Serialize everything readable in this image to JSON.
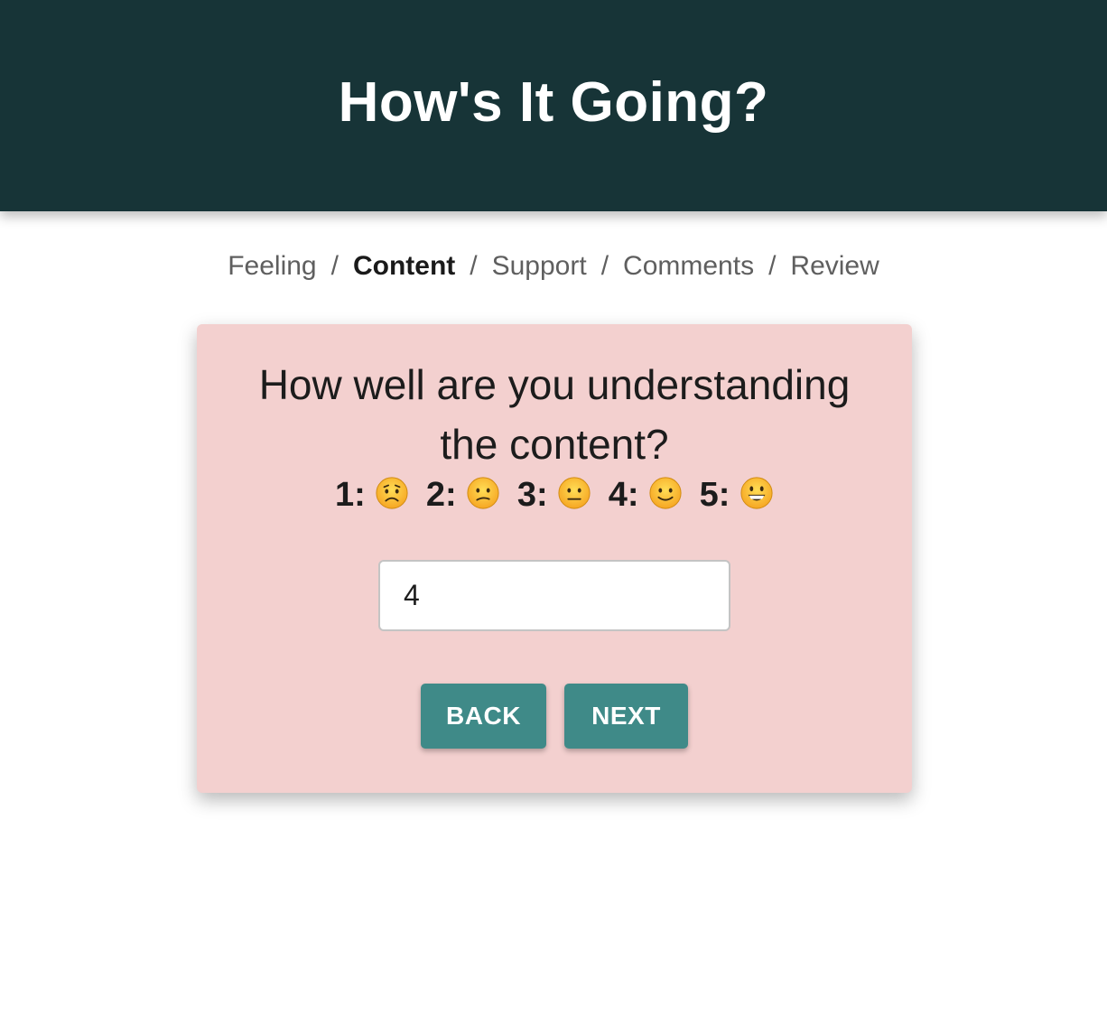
{
  "header": {
    "title": "How's It Going?",
    "bg_color": "#173437"
  },
  "breadcrumb": {
    "items": [
      {
        "label": "Feeling",
        "active": false
      },
      {
        "label": "Content",
        "active": true
      },
      {
        "label": "Support",
        "active": false
      },
      {
        "label": "Comments",
        "active": false
      },
      {
        "label": "Review",
        "active": false
      }
    ],
    "separator": "/"
  },
  "card": {
    "bg_color": "#f3d0cf",
    "question": "How well are you understanding the content?",
    "scale": [
      {
        "label": "1:",
        "icon": "worried-face-icon"
      },
      {
        "label": "2:",
        "icon": "confused-face-icon"
      },
      {
        "label": "3:",
        "icon": "neutral-face-icon"
      },
      {
        "label": "4:",
        "icon": "slightly-smiling-face-icon"
      },
      {
        "label": "5:",
        "icon": "grinning-face-icon"
      }
    ],
    "answer_value": "4",
    "back_label": "BACK",
    "next_label": "NEXT",
    "button_color": "#3f8a88"
  }
}
